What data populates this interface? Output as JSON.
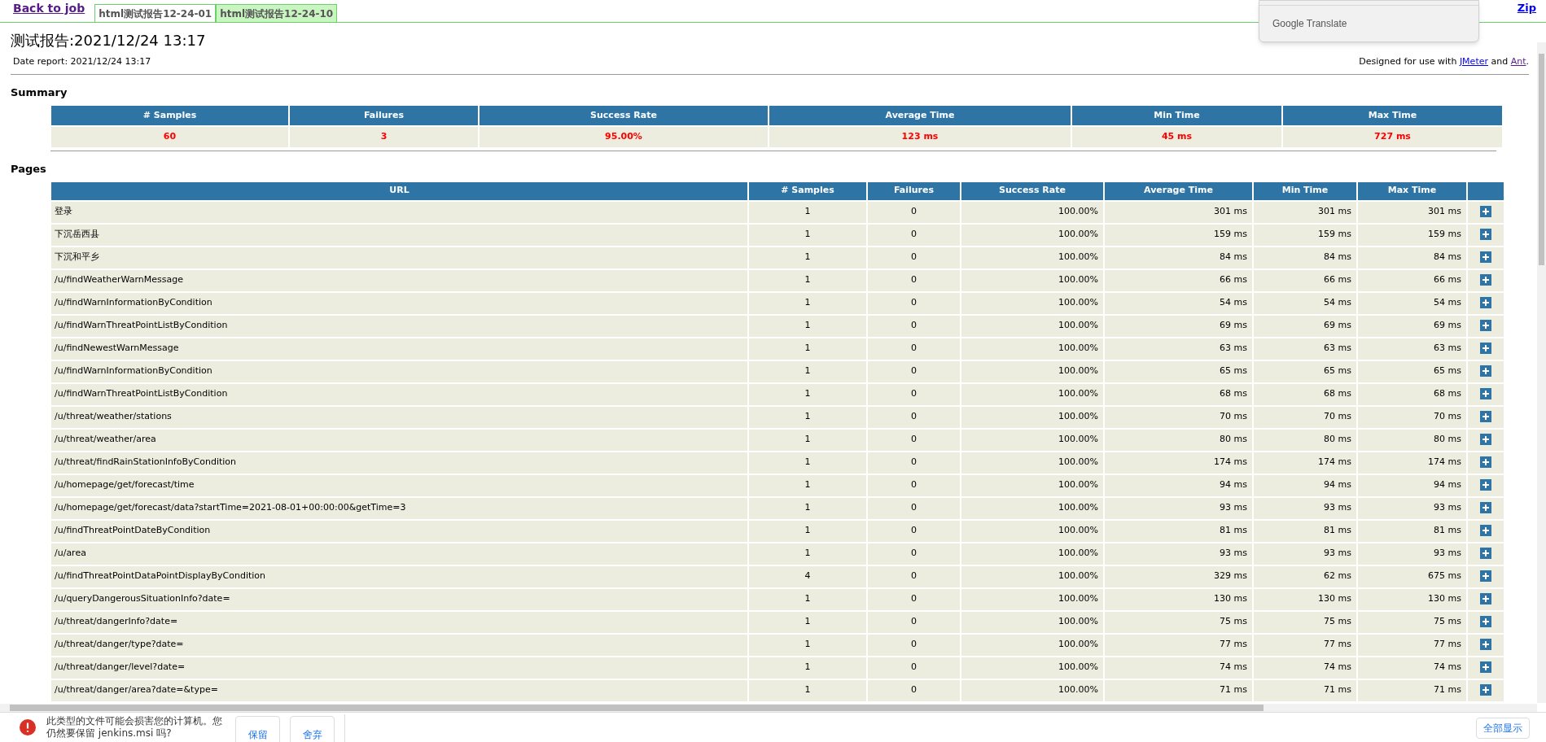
{
  "top_bar": {
    "back_link": "Back to job",
    "tabs": [
      {
        "label": "html测试报告12-24-01",
        "selected": false
      },
      {
        "label": "html测试报告12-24-10",
        "selected": true
      }
    ],
    "zip_link": "Zip"
  },
  "translate_popup": {
    "label": "Google Translate"
  },
  "title": "测试报告:2021/12/24 13:17",
  "date_report": "Date report: 2021/12/24 13:17",
  "designed_for": {
    "text": "Designed for use with",
    "link_1": "JMeter",
    "and": "and",
    "link_2": "Ant",
    "end": "."
  },
  "summary": {
    "heading": "Summary",
    "columns": [
      "# Samples",
      "Failures",
      "Success Rate",
      "Average Time",
      "Min Time",
      "Max Time"
    ],
    "values": [
      "60",
      "3",
      "95.00%",
      "123 ms",
      "45 ms",
      "727 ms"
    ]
  },
  "pages": {
    "heading": "Pages",
    "columns": [
      "URL",
      "# Samples",
      "Failures",
      "Success Rate",
      "Average Time",
      "Min Time",
      "Max Time"
    ],
    "rows": [
      {
        "url": "登录",
        "samples": "1",
        "failures": "0",
        "success_rate": "100.00%",
        "average_time": "301 ms",
        "min_time": "301 ms",
        "max_time": "301 ms"
      },
      {
        "url": "下沉岳西县",
        "samples": "1",
        "failures": "0",
        "success_rate": "100.00%",
        "average_time": "159 ms",
        "min_time": "159 ms",
        "max_time": "159 ms"
      },
      {
        "url": "下沉和平乡",
        "samples": "1",
        "failures": "0",
        "success_rate": "100.00%",
        "average_time": "84 ms",
        "min_time": "84 ms",
        "max_time": "84 ms"
      },
      {
        "url": "/u/findWeatherWarnMessage",
        "samples": "1",
        "failures": "0",
        "success_rate": "100.00%",
        "average_time": "66 ms",
        "min_time": "66 ms",
        "max_time": "66 ms"
      },
      {
        "url": "/u/findWarnInformationByCondition",
        "samples": "1",
        "failures": "0",
        "success_rate": "100.00%",
        "average_time": "54 ms",
        "min_time": "54 ms",
        "max_time": "54 ms"
      },
      {
        "url": "/u/findWarnThreatPointListByCondition",
        "samples": "1",
        "failures": "0",
        "success_rate": "100.00%",
        "average_time": "69 ms",
        "min_time": "69 ms",
        "max_time": "69 ms"
      },
      {
        "url": "/u/findNewestWarnMessage",
        "samples": "1",
        "failures": "0",
        "success_rate": "100.00%",
        "average_time": "63 ms",
        "min_time": "63 ms",
        "max_time": "63 ms"
      },
      {
        "url": "/u/findWarnInformationByCondition",
        "samples": "1",
        "failures": "0",
        "success_rate": "100.00%",
        "average_time": "65 ms",
        "min_time": "65 ms",
        "max_time": "65 ms"
      },
      {
        "url": "/u/findWarnThreatPointListByCondition",
        "samples": "1",
        "failures": "0",
        "success_rate": "100.00%",
        "average_time": "68 ms",
        "min_time": "68 ms",
        "max_time": "68 ms"
      },
      {
        "url": "/u/threat/weather/stations",
        "samples": "1",
        "failures": "0",
        "success_rate": "100.00%",
        "average_time": "70 ms",
        "min_time": "70 ms",
        "max_time": "70 ms"
      },
      {
        "url": "/u/threat/weather/area",
        "samples": "1",
        "failures": "0",
        "success_rate": "100.00%",
        "average_time": "80 ms",
        "min_time": "80 ms",
        "max_time": "80 ms"
      },
      {
        "url": "/u/threat/findRainStationInfoByCondition",
        "samples": "1",
        "failures": "0",
        "success_rate": "100.00%",
        "average_time": "174 ms",
        "min_time": "174 ms",
        "max_time": "174 ms"
      },
      {
        "url": "/u/homepage/get/forecast/time",
        "samples": "1",
        "failures": "0",
        "success_rate": "100.00%",
        "average_time": "94 ms",
        "min_time": "94 ms",
        "max_time": "94 ms"
      },
      {
        "url": "/u/homepage/get/forecast/data?startTime=2021-08-01+00:00:00&getTime=3",
        "samples": "1",
        "failures": "0",
        "success_rate": "100.00%",
        "average_time": "93 ms",
        "min_time": "93 ms",
        "max_time": "93 ms"
      },
      {
        "url": "/u/findThreatPointDateByCondition",
        "samples": "1",
        "failures": "0",
        "success_rate": "100.00%",
        "average_time": "81 ms",
        "min_time": "81 ms",
        "max_time": "81 ms"
      },
      {
        "url": "/u/area",
        "samples": "1",
        "failures": "0",
        "success_rate": "100.00%",
        "average_time": "93 ms",
        "min_time": "93 ms",
        "max_time": "93 ms"
      },
      {
        "url": "/u/findThreatPointDataPointDisplayByCondition",
        "samples": "4",
        "failures": "0",
        "success_rate": "100.00%",
        "average_time": "329 ms",
        "min_time": "62 ms",
        "max_time": "675 ms"
      },
      {
        "url": "/u/queryDangerousSituationInfo?date=",
        "samples": "1",
        "failures": "0",
        "success_rate": "100.00%",
        "average_time": "130 ms",
        "min_time": "130 ms",
        "max_time": "130 ms"
      },
      {
        "url": "/u/threat/dangerInfo?date=",
        "samples": "1",
        "failures": "0",
        "success_rate": "100.00%",
        "average_time": "75 ms",
        "min_time": "75 ms",
        "max_time": "75 ms"
      },
      {
        "url": "/u/threat/danger/type?date=",
        "samples": "1",
        "failures": "0",
        "success_rate": "100.00%",
        "average_time": "77 ms",
        "min_time": "77 ms",
        "max_time": "77 ms"
      },
      {
        "url": "/u/threat/danger/level?date=",
        "samples": "1",
        "failures": "0",
        "success_rate": "100.00%",
        "average_time": "74 ms",
        "min_time": "74 ms",
        "max_time": "74 ms"
      },
      {
        "url": "/u/threat/danger/area?date=&type=",
        "samples": "1",
        "failures": "0",
        "success_rate": "100.00%",
        "average_time": "71 ms",
        "min_time": "71 ms",
        "max_time": "71 ms"
      }
    ]
  },
  "download_bar": {
    "message": "此类型的文件可能会损害您的计算机。您仍然要保留 jenkins.msi 吗?",
    "buttons": [
      "保留",
      "舍弃"
    ],
    "show_all": "全部显示"
  }
}
